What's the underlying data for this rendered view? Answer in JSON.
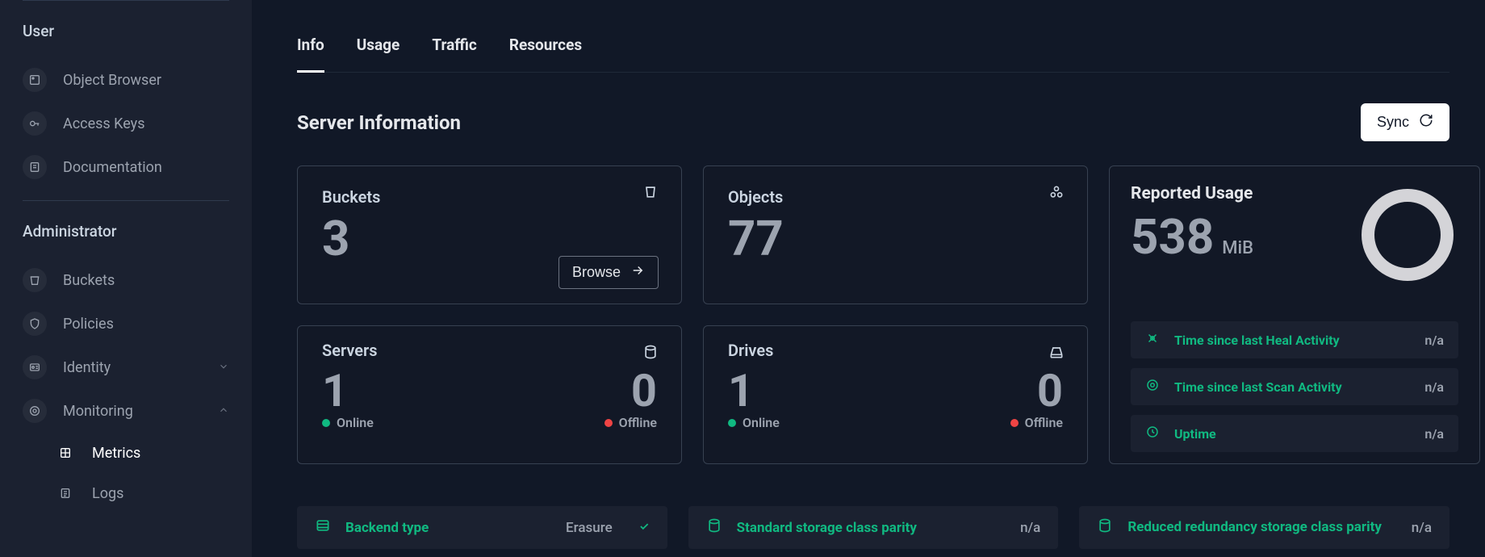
{
  "sidebar": {
    "user_section_title": "User",
    "admin_section_title": "Administrator",
    "user_items": [
      {
        "label": "Object Browser"
      },
      {
        "label": "Access Keys"
      },
      {
        "label": "Documentation"
      }
    ],
    "admin_items": [
      {
        "label": "Buckets"
      },
      {
        "label": "Policies"
      },
      {
        "label": "Identity",
        "expandable": true
      },
      {
        "label": "Monitoring",
        "expandable": true,
        "expanded": true
      }
    ],
    "monitoring_children": [
      {
        "label": "Metrics",
        "active": true
      },
      {
        "label": "Logs"
      }
    ]
  },
  "tabs": [
    {
      "label": "Info",
      "active": true
    },
    {
      "label": "Usage"
    },
    {
      "label": "Traffic"
    },
    {
      "label": "Resources"
    }
  ],
  "page_title": "Server Information",
  "sync_label": "Sync",
  "cards": {
    "buckets": {
      "label": "Buckets",
      "value": "3",
      "browse_label": "Browse"
    },
    "objects": {
      "label": "Objects",
      "value": "77"
    },
    "servers": {
      "label": "Servers",
      "online": "1",
      "offline": "0",
      "online_label": "Online",
      "offline_label": "Offline"
    },
    "drives": {
      "label": "Drives",
      "online": "1",
      "offline": "0",
      "online_label": "Online",
      "offline_label": "Offline"
    }
  },
  "usage": {
    "title": "Reported Usage",
    "value": "538",
    "unit": "MiB",
    "rows": [
      {
        "label": "Time since last Heal Activity",
        "value": "n/a"
      },
      {
        "label": "Time since last Scan Activity",
        "value": "n/a"
      },
      {
        "label": "Uptime",
        "value": "n/a"
      }
    ]
  },
  "strips": [
    {
      "label": "Backend type",
      "value": "Erasure",
      "has_check": true
    },
    {
      "label": "Standard storage class parity",
      "value": "n/a"
    },
    {
      "label": "Reduced redundancy storage class parity",
      "value": "n/a"
    }
  ]
}
